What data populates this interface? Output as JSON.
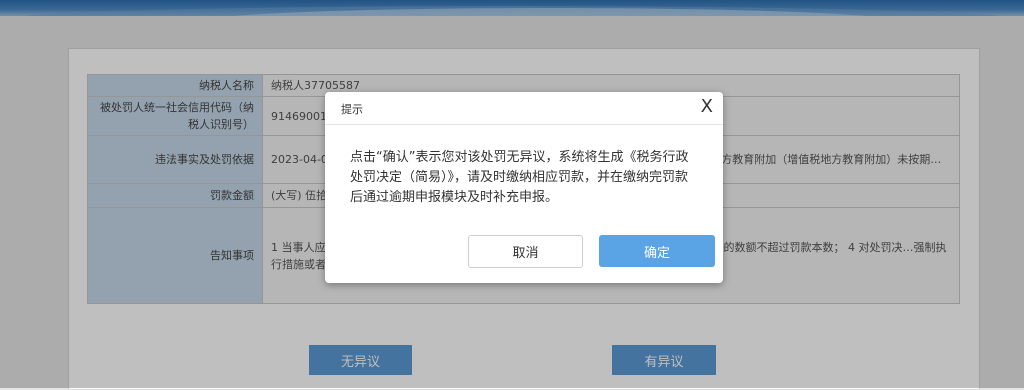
{
  "form": {
    "rows": [
      {
        "label": "纳税人名称",
        "value": "纳税人37705587"
      },
      {
        "label": "被处罚人统一社会信用代码（纳税人识别号）",
        "value": "91469001"
      },
      {
        "label": "违法事实及处罚依据",
        "value": "2023-04-0… 税（县城、镇（增值税附征））未按期进行申报 2023-04-0… 2023-04-30 地方教育附加（增值税地方教育附加）未按期…"
      },
      {
        "label": "罚款金额",
        "value": "(大写) 伍拾…"
      },
      {
        "label": "告知事项",
        "value": "1 当事人应… 2 如对本决…决定书之日起6个月内依法向人民法院起诉。 3 到期不缴…处罚款的数额不超过罚款本数； 4 对处罚决…强制执行措施或者申请人民法院强制执行。"
      }
    ]
  },
  "actions": {
    "no_objection": "无异议",
    "has_objection": "有异议"
  },
  "dialog": {
    "title": "提示",
    "close": "X",
    "message": "点击“确认”表示您对该处罚无异议，系统将生成《税务行政处罚决定（简易）》，请及时缴纳相应罚款，并在缴纳完罚款后通过逾期申报模块及时补充申报。",
    "cancel": "取消",
    "confirm": "确定"
  }
}
